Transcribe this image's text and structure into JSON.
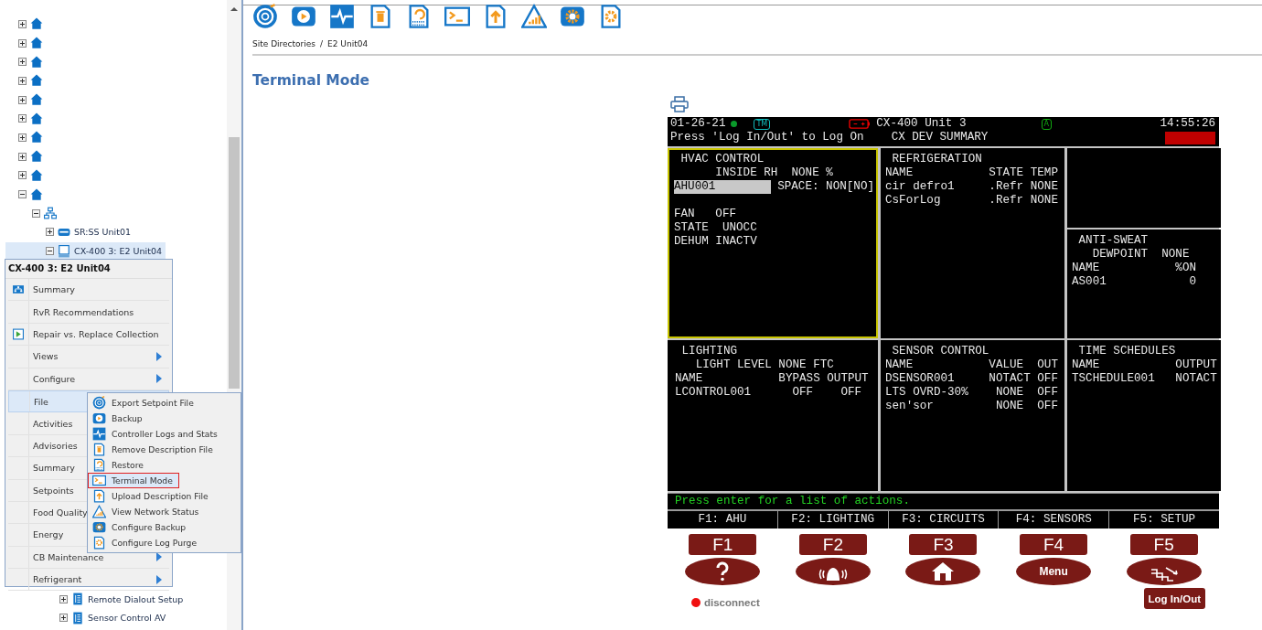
{
  "tree": [
    {
      "kind": "site",
      "expanded": false,
      "selected": false
    },
    {
      "kind": "site",
      "expanded": false,
      "selected": false
    },
    {
      "kind": "site",
      "expanded": false,
      "selected": false
    },
    {
      "kind": "site",
      "expanded": false,
      "selected": false
    },
    {
      "kind": "site",
      "expanded": false,
      "selected": false
    },
    {
      "kind": "site",
      "expanded": false,
      "selected": false
    },
    {
      "kind": "site",
      "expanded": false,
      "selected": false
    },
    {
      "kind": "site",
      "expanded": false,
      "selected": false
    },
    {
      "kind": "site",
      "expanded": false,
      "selected": false
    },
    {
      "kind": "site",
      "expanded": true,
      "selected": false,
      "children": [
        {
          "kind": "network",
          "expanded": true,
          "selected": false,
          "children": [
            {
              "kind": "unit",
              "label": "SR:SS Unit01",
              "expanded": false,
              "selected": false
            },
            {
              "kind": "controller",
              "label": "CX-400 3: E2 Unit04",
              "expanded": true,
              "selected": true,
              "children": [
                {
                  "kind": "application",
                  "label": "Remote Dialout Setup",
                  "expanded": false,
                  "selected": false
                },
                {
                  "kind": "application",
                  "label": "Sensor Control AV",
                  "expanded": false,
                  "selected": false
                }
              ]
            }
          ]
        }
      ]
    }
  ],
  "context_menu": {
    "title": "CX-400 3: E2 Unit04",
    "items": [
      {
        "label": "Summary",
        "kind": "summary",
        "submenu": false,
        "selected": false
      },
      {
        "label": "RvR Recommendations",
        "kind": "plain",
        "submenu": false,
        "selected": false
      },
      {
        "label": "Repair vs. Replace Collection",
        "kind": "collection",
        "submenu": false,
        "selected": false
      },
      {
        "label": "Views",
        "kind": "plain",
        "submenu": true,
        "selected": false
      },
      {
        "label": "Configure",
        "kind": "plain",
        "submenu": true,
        "selected": false
      },
      {
        "label": "File",
        "kind": "plain",
        "submenu": true,
        "selected": true
      },
      {
        "label": "Activities",
        "kind": "plain",
        "selected": false
      },
      {
        "label": "Advisories",
        "kind": "plain",
        "selected": false
      },
      {
        "label": "Summary",
        "kind": "plain",
        "selected": false
      },
      {
        "label": "Setpoints",
        "kind": "plain",
        "selected": false
      },
      {
        "label": "Food Quality",
        "kind": "plain",
        "selected": false
      },
      {
        "label": "Energy",
        "kind": "plain",
        "selected": false
      },
      {
        "label": "CB Maintenance",
        "kind": "plain",
        "submenu": true,
        "selected": false
      },
      {
        "label": "Refrigerant",
        "kind": "plain",
        "submenu": true,
        "selected": false
      }
    ]
  },
  "file_submenu": [
    {
      "label": "Export Setpoint File",
      "kind": "export",
      "selected": false
    },
    {
      "label": "Backup",
      "kind": "backup",
      "selected": false
    },
    {
      "label": "Controller Logs and Stats",
      "kind": "logs",
      "selected": false
    },
    {
      "label": "Remove Description File",
      "kind": "remove",
      "selected": false
    },
    {
      "label": "Restore",
      "kind": "restore",
      "selected": false
    },
    {
      "label": "Terminal Mode",
      "kind": "terminal",
      "selected": true
    },
    {
      "label": "Upload Description File",
      "kind": "upload",
      "selected": false
    },
    {
      "label": "View Network Status",
      "kind": "network",
      "selected": false
    },
    {
      "label": "Configure Backup",
      "kind": "config_backup",
      "selected": false
    },
    {
      "label": "Configure Log Purge",
      "kind": "log_purge",
      "selected": false
    }
  ],
  "toolbar": [
    {
      "kind": "export"
    },
    {
      "kind": "backup"
    },
    {
      "kind": "logs"
    },
    {
      "kind": "remove"
    },
    {
      "kind": "restore"
    },
    {
      "kind": "terminal"
    },
    {
      "kind": "upload"
    },
    {
      "kind": "network"
    },
    {
      "kind": "config_backup"
    },
    {
      "kind": "log_purge"
    }
  ],
  "breadcrumb": {
    "items": [
      "Site Directories",
      "E2 Unit04"
    ],
    "separator": "/"
  },
  "title": "Terminal Mode",
  "terminal": {
    "date": "01-26-21",
    "tm_badge": "TM",
    "unit": "CX-400 Unit 3",
    "lock_badge": "A",
    "time": "14:55:26",
    "message": "Press 'Log In/Out' to Log On",
    "screen": "CX DEV SUMMARY",
    "hvac": {
      "title": " HVAC CONTROL",
      "selected": true,
      "lines_top": [
        "      INSIDE RH  NONE %"
      ],
      "field": "AHU001",
      "field_text": "SPACE: NON[NO]",
      "lines": [
        "FAN   OFF",
        "STATE  UNOCC",
        "DEHUM INACTV"
      ]
    },
    "panels": [
      {
        "title": " REFRIGERATION",
        "selected": false,
        "lines": [
          "NAME           STATE TEMP",
          "cir defro1     .Refr NONE",
          "CsForLog       .Refr NONE"
        ]
      },
      {
        "title": " ANTI-SWEAT",
        "selected": false,
        "lines": [
          "   DEWPOINT  NONE",
          "NAME           %ON",
          "AS001            0"
        ]
      },
      {
        "title": " LIGHTING",
        "selected": false,
        "lines": [
          "   LIGHT LEVEL NONE FTC",
          "NAME           BYPASS OUTPUT",
          "LCONTROL001      OFF    OFF"
        ]
      },
      {
        "title": " SENSOR CONTROL",
        "selected": false,
        "lines": [
          "NAME           VALUE  OUT",
          "DSENSOR001     NOTACT OFF",
          "LTS OVRD-30%    NONE  OFF",
          "sen'sor         NONE  OFF"
        ]
      },
      {
        "title": " TIME SCHEDULES",
        "selected": false,
        "lines": [
          "NAME           OUTPUT",
          "TSCHEDULE001   NOTACT"
        ]
      }
    ],
    "status": "Press enter for a list of actions.",
    "keys": [
      {
        "label": "F1",
        "tab": "F1: AHU",
        "kind": "help"
      },
      {
        "label": "F2",
        "tab": "F2: LIGHTING",
        "kind": "alarm"
      },
      {
        "label": "F3",
        "tab": "F3: CIRCUITS",
        "kind": "home"
      },
      {
        "label": "F4",
        "tab": "F4: SENSORS",
        "kind": "menu",
        "text": "Menu"
      },
      {
        "label": "F5",
        "tab": "F5: SETUP",
        "kind": "setup"
      }
    ],
    "connection": "disconnect",
    "login": "Log In/Out"
  }
}
